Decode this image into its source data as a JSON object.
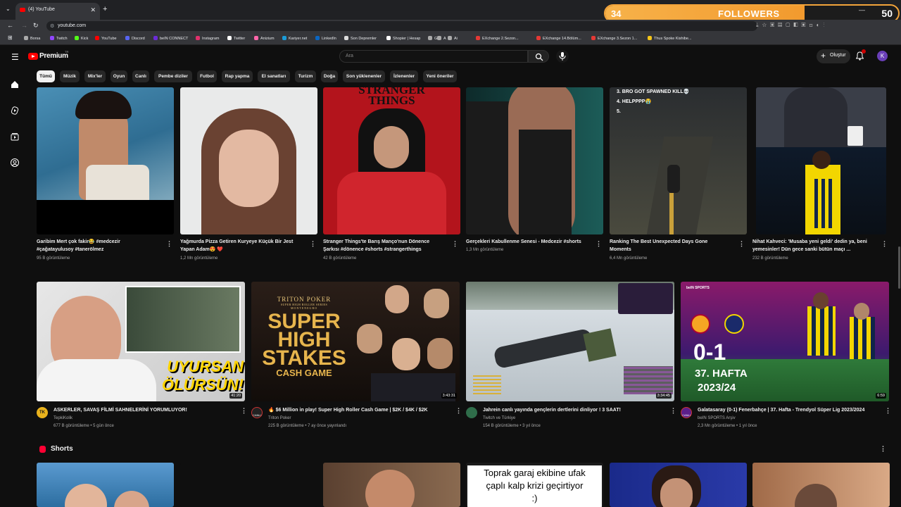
{
  "browser": {
    "tab_title": "(4) YouTube",
    "new_tab_glyph": "+",
    "url": "youtube.com",
    "bookmarks": [
      "Borsa",
      "Twitch",
      "Kick",
      "YouTube",
      "Discord",
      "beIN CONNECT",
      "Instagram",
      "Twitter",
      "Anizium",
      "Kariyer.net",
      "LinkedIn",
      "Son Depremler",
      "Shopier | Hesap",
      "G",
      "A",
      "Ai",
      "EXchange 2.Sezon...",
      "EXchange 14.Bölüm...",
      "EXchange 3.Sezon 1...",
      "Thus Spoke Kishibe..."
    ],
    "bookmark_colors": [
      "#aaaaaa",
      "#9146ff",
      "#53fc18",
      "#ff0000",
      "#5865f2",
      "#6b2bd9",
      "#e1306c",
      "#ffffff",
      "#ff66aa",
      "#1a9bd8",
      "#0a66c2",
      "#dddddd",
      "#ffffff",
      "#aaaaaa",
      "#aaaaaa",
      "#aaaaaa",
      "#e53935",
      "#e53935",
      "#e53935",
      "#f5c518"
    ]
  },
  "overlay": {
    "followers_current": "34",
    "followers_label": "FOLLOWERS",
    "followers_goal": "50",
    "progress_fraction": 0.68,
    "color": "#f3a43a"
  },
  "header": {
    "logo_text": "Premium",
    "logo_tm": "TR",
    "search_placeholder": "Ara",
    "create_label": "Oluştur",
    "avatar_letter": "K",
    "notification_badge": "4"
  },
  "chips": [
    "Tümü",
    "Müzik",
    "Mix'ler",
    "Oyun",
    "Canlı",
    "Pembe diziler",
    "Futbol",
    "Rap yapma",
    "El sanatları",
    "Turizm",
    "Doğa",
    "Son yüklenenler",
    "İzlenenler",
    "Yeni öneriler"
  ],
  "row1": [
    {
      "title1": "Garibim Mert çok fakir😂 #medcezir",
      "title2": "#çağatayulusoy #tanerölmez",
      "meta": "95 B görüntüleme"
    },
    {
      "title1": "Yağmurda Pizza Getiren Kuryeye Küçük Bir Jest",
      "title2": "Yapan Adam😍 ❤️",
      "meta": "1,2 Mn görüntüleme"
    },
    {
      "title1": "Stranger Things'te Barış Manço'nun Dönence",
      "title2": "Şarkısı #dönence #shorts #strangerthings",
      "meta": "42 B görüntüleme",
      "thumb_text": "STRANGER THINGS"
    },
    {
      "title1": "Gerçekleri Kabullenme Senesi - Medcezir #shorts",
      "title2": "",
      "meta": "1,3 Mn görüntüleme"
    },
    {
      "title1": "Ranking The Best Unexpected Days Gone",
      "title2": "Moments",
      "meta": "6,4 Mn görüntüleme",
      "thumb_text": [
        "3. BRO GOT SPAWNED KILL💀",
        "4. HELPPPP😭",
        "5."
      ]
    },
    {
      "title1": "Nihat Kahveci: 'Musaba yeni geldi' dedin ya, beni",
      "title2": "yemesinler! Dün gece sanki bütün maçı ...",
      "meta": "232 B görüntüleme"
    }
  ],
  "row2": [
    {
      "title": "ASKERLER, SAVAŞ FİLMİ SAHNELERİNİ YORUMLUYOR!",
      "channel": "TepkiKolik",
      "meta": "677 B görüntüleme • 5 gün önce",
      "duration": "41:20",
      "thumb_text": [
        "UYURSAN",
        "ÖLÜRSÜN!"
      ],
      "channel_initials": "TK"
    },
    {
      "title": "🔥 $6 Million in play! Super High Roller Cash Game | $2K / $4K / $2K",
      "channel": "Triton Poker",
      "meta": "225 B görüntüleme • 7 ay önce yayınlandı",
      "duration": "3:43:31",
      "thumb_text": [
        "TRITON POKER",
        "SUPER HIGH ROLLER SERIES",
        "MONTENEGRO",
        "SUPER",
        "HIGH",
        "STAKES",
        "CASH GAME"
      ],
      "channel_badge": "CANLI"
    },
    {
      "title": "Jahrein canlı yayında gençlerin dertlerini dinliyor ! 3 SAAT!",
      "channel": "Twitch ve Türkiye",
      "meta": "154 B görüntüleme • 3 yıl önce",
      "duration": "3:34:45"
    },
    {
      "title": "Galatasaray (0-1) Fenerbahçe | 37. Hafta - Trendyol Süper Lig 2023/2024",
      "channel": "beIN SPORTS Arşiv",
      "meta": "2,3 Mn görüntüleme • 1 yıl önce",
      "duration": "6:59",
      "thumb_text": [
        "beIN SPORTS",
        "0-1",
        "37. HAFTA",
        "2023/24"
      ],
      "channel_badge": "CANLI"
    }
  ],
  "shorts": {
    "heading": "Shorts",
    "caption": [
      "Toprak garaj ekibine ufak",
      "çaplı kalp krizi geçirtiyor",
      ":)"
    ]
  }
}
